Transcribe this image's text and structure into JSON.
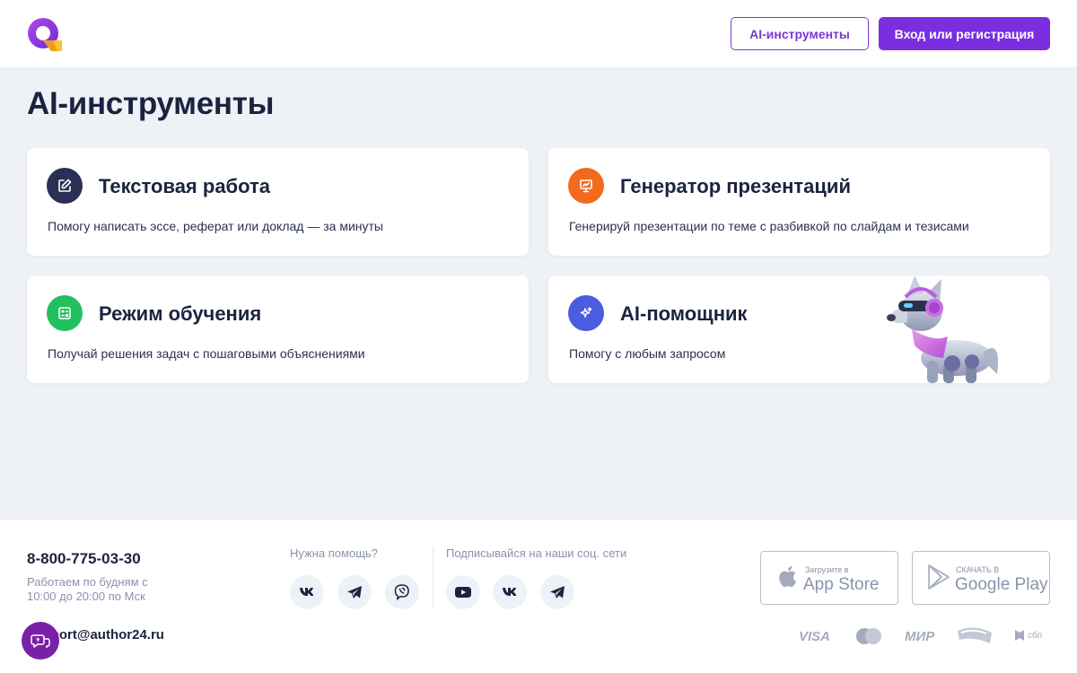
{
  "header": {
    "ai_tools_button": "AI-инструменты",
    "login_button": "Вход или регистрация"
  },
  "page_title": "AI-инструменты",
  "cards": [
    {
      "title": "Текстовая работа",
      "desc": "Помогу написать эссе, реферат или доклад — за минуты",
      "icon": "edit-note-icon",
      "color": "#2b2f55"
    },
    {
      "title": "Генератор презентаций",
      "desc": "Генерируй презентации по теме с разбивкой по слайдам и тезисами",
      "icon": "presentation-icon",
      "color": "#f26b1d"
    },
    {
      "title": "Режим обучения",
      "desc": "Получай решения задач с пошаговыми объяснениями",
      "icon": "calculator-icon",
      "color": "#23c060"
    },
    {
      "title": "AI-помощник",
      "desc": "Помогу с любым запросом",
      "icon": "sparkle-icon",
      "color": "#4a5ce0"
    }
  ],
  "footer": {
    "phone": "8-800-775-03-30",
    "hours": "Работаем по будням с 10:00 до 20:00 по Мск",
    "email": "support@author24.ru",
    "help_label": "Нужна помощь?",
    "social_label": "Подписывайся на наши соц. сети",
    "app_store_small": "Загрузите в",
    "app_store_big": "App Store",
    "google_play_small": "СКАЧАТЬ В",
    "google_play_big": "Google Play",
    "payments": [
      "VISA",
      "МИР",
      "сбп"
    ]
  },
  "colors": {
    "accent": "#7b2ee0",
    "background": "#eef1f6",
    "text": "#1c2340",
    "muted": "#8a93ab"
  }
}
